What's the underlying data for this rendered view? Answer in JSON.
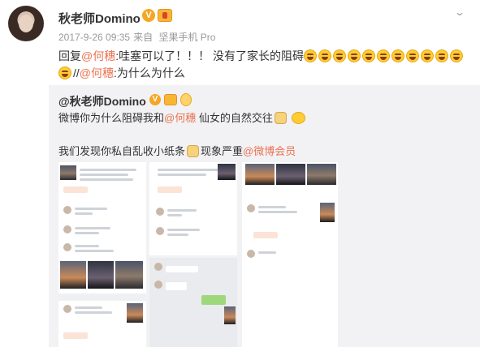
{
  "post": {
    "username": "秋老师Domino",
    "verified_badge": "V",
    "date": "2017-9-26 09:35",
    "source_prefix": "来自",
    "source": "坚果手机 Pro",
    "reply_prefix": "回复",
    "mention1": "@何穗",
    "text1": ":哇塞可以了！！！ 没有了家长的阻碍",
    "line2_sep": "//",
    "mention2": "@何穗",
    "text2": ":为什么为什么",
    "emoji_count_line1": 11,
    "emoji_icon": "laughing-tears-icon"
  },
  "repost": {
    "username": "@秋老师Domino",
    "verified_badge": "V",
    "line1_prefix": "微博你为什么阻碍我和",
    "line1_mention": "@何穗",
    "line1_suffix": " 仙女的自然交往",
    "line2_prefix": "我们发现你私自乱收小纸条",
    "line2_middle": "现象严重",
    "line2_mention": "@微博会员"
  },
  "colors": {
    "link": "#eb7350",
    "repost_bg": "#f2f2f5",
    "badge": "#f5a623",
    "meta": "#999999"
  },
  "icons": {
    "menu": "chevron-down-icon",
    "badge1": "verified-v-icon",
    "badge2": "vip-level-icon",
    "emoji_pet": "doge-icon",
    "emoji_hug": "hug-icon"
  }
}
